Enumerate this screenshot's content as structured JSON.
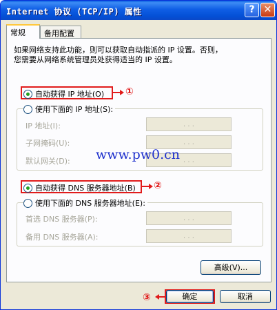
{
  "window": {
    "title": "Internet 协议 (TCP/IP) 属性",
    "help_icon": "?",
    "close_icon": "✕"
  },
  "tabs": [
    {
      "label": "常规",
      "active": true
    },
    {
      "label": "备用配置",
      "active": false
    }
  ],
  "description": {
    "line1": "如果网络支持此功能，则可以获取自动指派的 IP 设置。否则，",
    "line2": "您需要从网络系统管理员处获得适当的 IP 设置。"
  },
  "ip_section": {
    "auto_label": "自动获得 IP 地址(O)",
    "auto_checked": true,
    "manual_label": "使用下面的 IP 地址(S):",
    "manual_checked": false,
    "fields": [
      {
        "label": "IP 地址(I):",
        "value": ".   .   ."
      },
      {
        "label": "子网掩码(U):",
        "value": ".   .   ."
      },
      {
        "label": "默认网关(D):",
        "value": ".   .   ."
      }
    ]
  },
  "dns_section": {
    "auto_label": "自动获得 DNS 服务器地址(B)",
    "auto_checked": true,
    "manual_label": "使用下面的 DNS 服务器地址(E):",
    "manual_checked": false,
    "fields": [
      {
        "label": "首选 DNS 服务器(P):",
        "value": ".   .   ."
      },
      {
        "label": "备用 DNS 服务器(A):",
        "value": ".   .   ."
      }
    ]
  },
  "watermark": "www.pw0.cn",
  "buttons": {
    "advanced": "高级(V)...",
    "ok": "确定",
    "cancel": "取消"
  },
  "annotations": {
    "one": "①",
    "two": "②",
    "three": "③"
  },
  "colors": {
    "titlebar": "#0450d6",
    "annotation": "#e11b1b",
    "watermark": "#1d2fcc",
    "radio_dot": "#21a121"
  }
}
